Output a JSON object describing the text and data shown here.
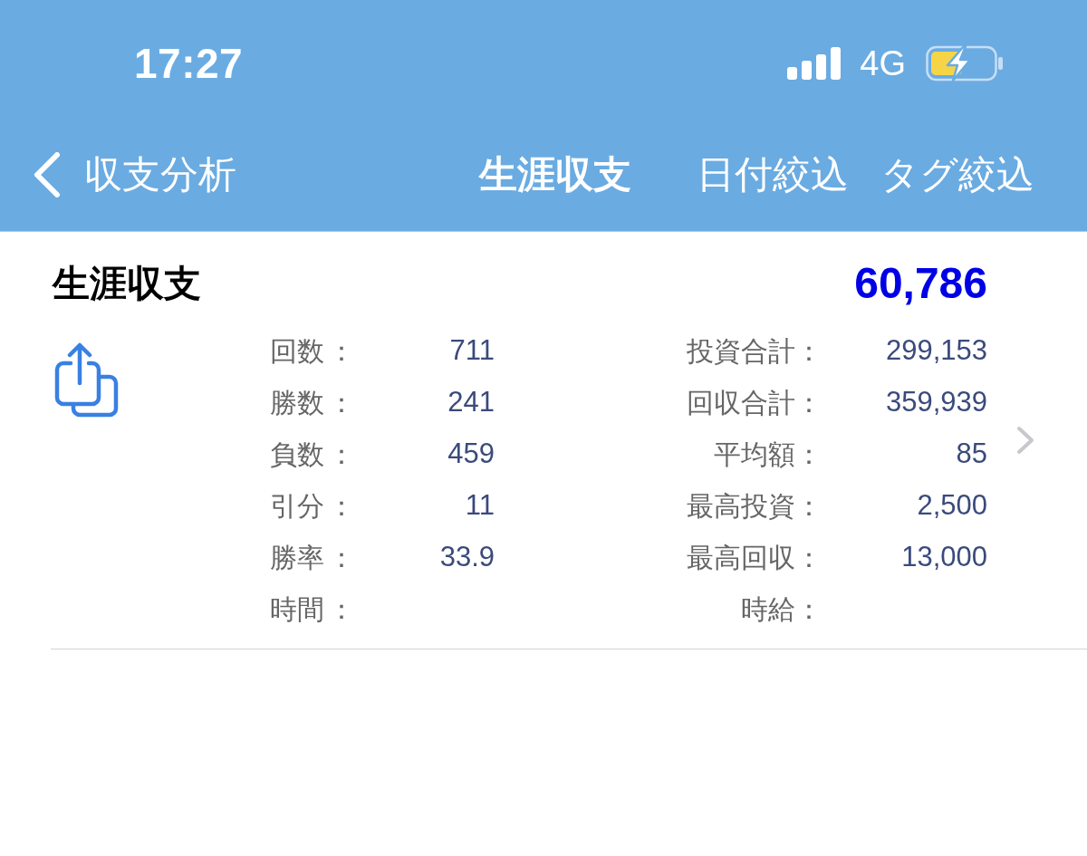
{
  "status_bar": {
    "time": "17:27",
    "network": "4G",
    "charging": true
  },
  "nav_bar": {
    "back": {
      "label": "収支分析"
    },
    "tabs": [
      {
        "label": "生涯収支",
        "selected": true
      },
      {
        "label": "日付絞込",
        "selected": false
      },
      {
        "label": "タグ絞込",
        "selected": false
      }
    ]
  },
  "summary": {
    "title": "生涯収支",
    "total": "60,786",
    "stats_left": [
      {
        "label": "回数",
        "separator": "：",
        "value": "711"
      },
      {
        "label": "勝数",
        "separator": "：",
        "value": "241"
      },
      {
        "label": "負数",
        "separator": "：",
        "value": "459"
      },
      {
        "label": "引分",
        "separator": "：",
        "value": "11"
      },
      {
        "label": "勝率",
        "separator": "：",
        "value": "33.9"
      },
      {
        "label": "時間",
        "separator": "："
      }
    ],
    "stats_right": [
      {
        "label": "投資合計",
        "separator": "：",
        "value": "299,153"
      },
      {
        "label": "回収合計",
        "separator": "：",
        "value": "359,939"
      },
      {
        "label": "平均額",
        "separator": "：",
        "value": "85"
      },
      {
        "label": "最高投資",
        "separator": "：",
        "value": "2,500"
      },
      {
        "label": "最高回収",
        "separator": "：",
        "value": "13,000"
      },
      {
        "label": "時給",
        "separator": "："
      }
    ]
  }
}
